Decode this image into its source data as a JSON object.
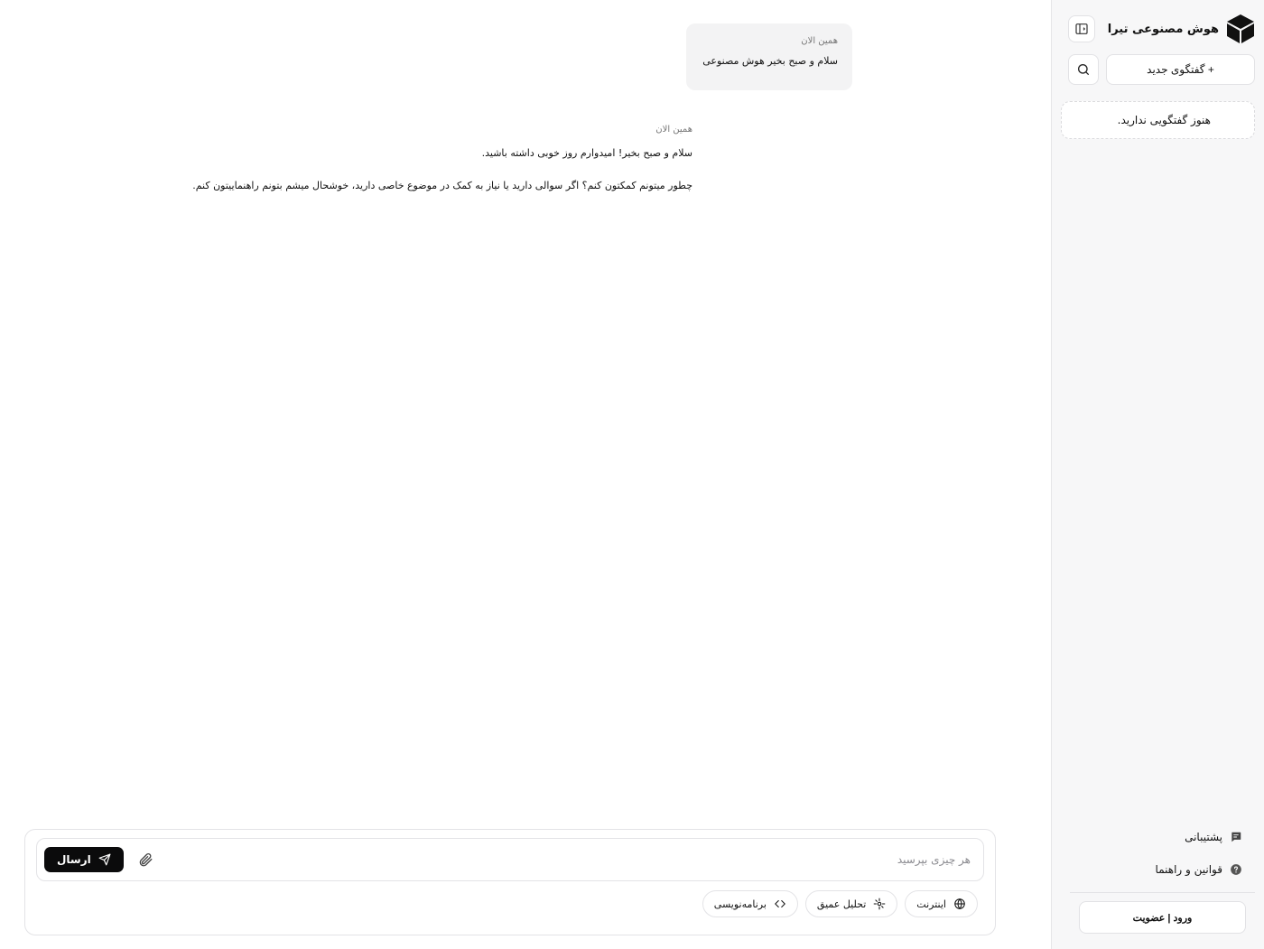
{
  "sidebar": {
    "brand_name": "هوش مصنوعی تیرا",
    "new_chat_label": "+ گفتگوی جدید",
    "empty_state": "هنوز گفتگویی ندارید.",
    "links": [
      {
        "label": "پشتیبانی",
        "icon": "chat-icon"
      },
      {
        "label": "قوانین و راهنما",
        "icon": "help-icon"
      }
    ],
    "login_label": "ورود | عضویت"
  },
  "chat": {
    "user_message": {
      "time": "همین الان",
      "text": "سلام و صبح بخیر هوش مصنوعی"
    },
    "ai_message": {
      "time": "همین الان",
      "lines": [
        "سلام و صبح بخیر! امیدوارم روز خوبی داشته باشید.",
        "چطور میتونم کمکتون کنم؟ اگر سوالی دارید یا نیاز به کمک در موضوع خاصی دارید، خوشحال میشم بتونم راهنماییتون کنم."
      ]
    }
  },
  "composer": {
    "placeholder": "هر چیزی بپرسید",
    "send_label": "ارسال",
    "tools": [
      {
        "label": "اینترنت",
        "icon": "globe-icon"
      },
      {
        "label": "تحلیل عمیق",
        "icon": "sparkle-icon"
      },
      {
        "label": "برنامه‌نویسی",
        "icon": "code-icon"
      }
    ]
  }
}
